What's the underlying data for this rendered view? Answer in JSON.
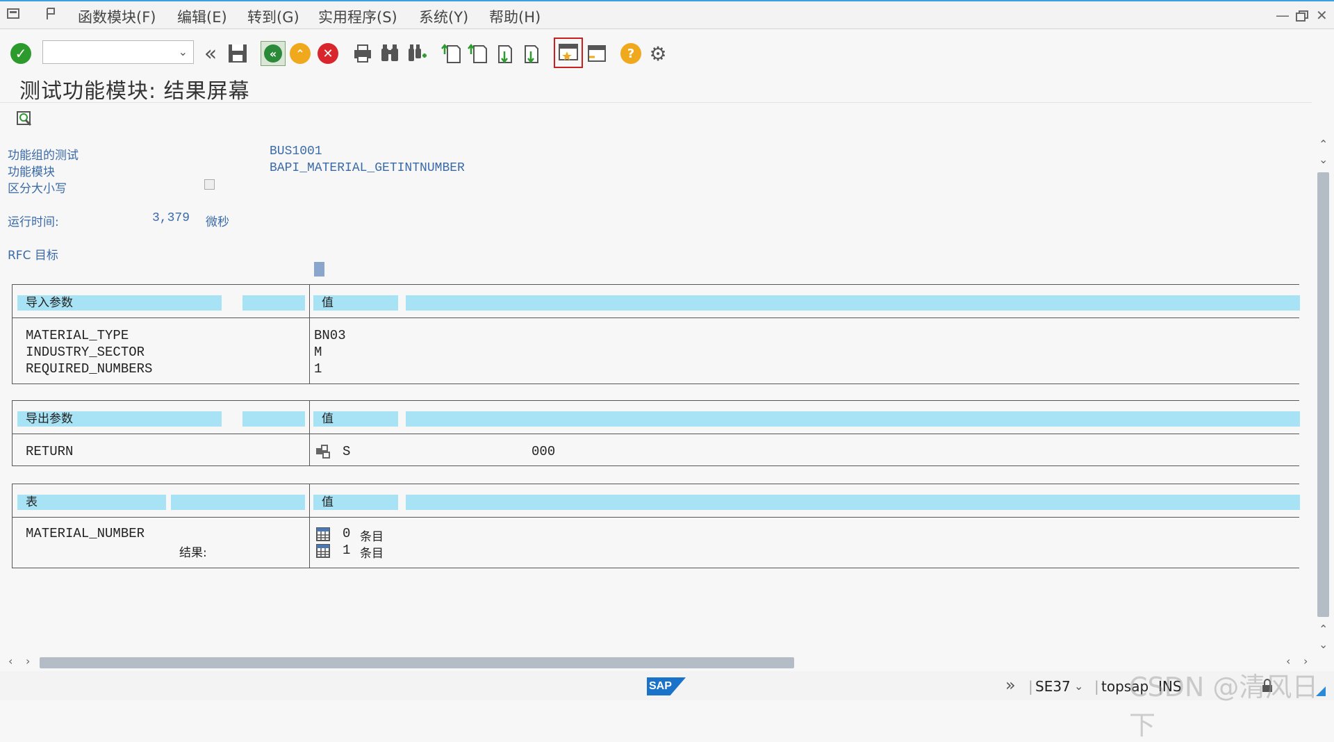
{
  "menu": {
    "items": [
      "函数模块(F)",
      "编辑(E)",
      "转到(G)",
      "实用程序(S)",
      "系统(Y)",
      "帮助(H)"
    ]
  },
  "toolbar": {
    "command_value": "",
    "icons": [
      "enter-icon",
      "back-double-icon",
      "save-icon",
      "back-icon",
      "exit-icon",
      "cancel-icon",
      "print-icon",
      "find-icon",
      "find-next-icon",
      "first-page-icon",
      "prev-page-icon",
      "next-page-icon",
      "last-page-icon",
      "create-session-icon",
      "shortcut-icon",
      "help-icon",
      "settings-icon"
    ]
  },
  "title": "测试功能模块: 结果屏幕",
  "header": {
    "function_group_label": "功能组的测试",
    "function_group_value": "BUS1001",
    "function_module_label": "功能模块",
    "function_module_value": "BAPI_MATERIAL_GETINTNUMBER",
    "case_sensitive_label": "区分大小写",
    "runtime_label": "运行时间:",
    "runtime_value": "3,379",
    "runtime_unit": "微秒",
    "rfc_label": "RFC 目标"
  },
  "import_params": {
    "header": "导入参数",
    "value_header": "值",
    "rows": [
      {
        "name": "MATERIAL_TYPE",
        "value": "BN03"
      },
      {
        "name": "INDUSTRY_SECTOR",
        "value": "M"
      },
      {
        "name": "REQUIRED_NUMBERS",
        "value": "1"
      }
    ]
  },
  "export_params": {
    "header": "导出参数",
    "value_header": "值",
    "rows": [
      {
        "name": "RETURN",
        "value": "S",
        "extra": "000"
      }
    ]
  },
  "tables": {
    "header": "表",
    "value_header": "值",
    "name": "MATERIAL_NUMBER",
    "result_label": "结果:",
    "entries": [
      {
        "count": "0",
        "unit": "条目"
      },
      {
        "count": "1",
        "unit": "条目"
      }
    ]
  },
  "status": {
    "transaction": "SE37",
    "system": "topsap",
    "mode": "INS",
    "logo": "SAP"
  },
  "watermark": "CSDN @清风日下"
}
